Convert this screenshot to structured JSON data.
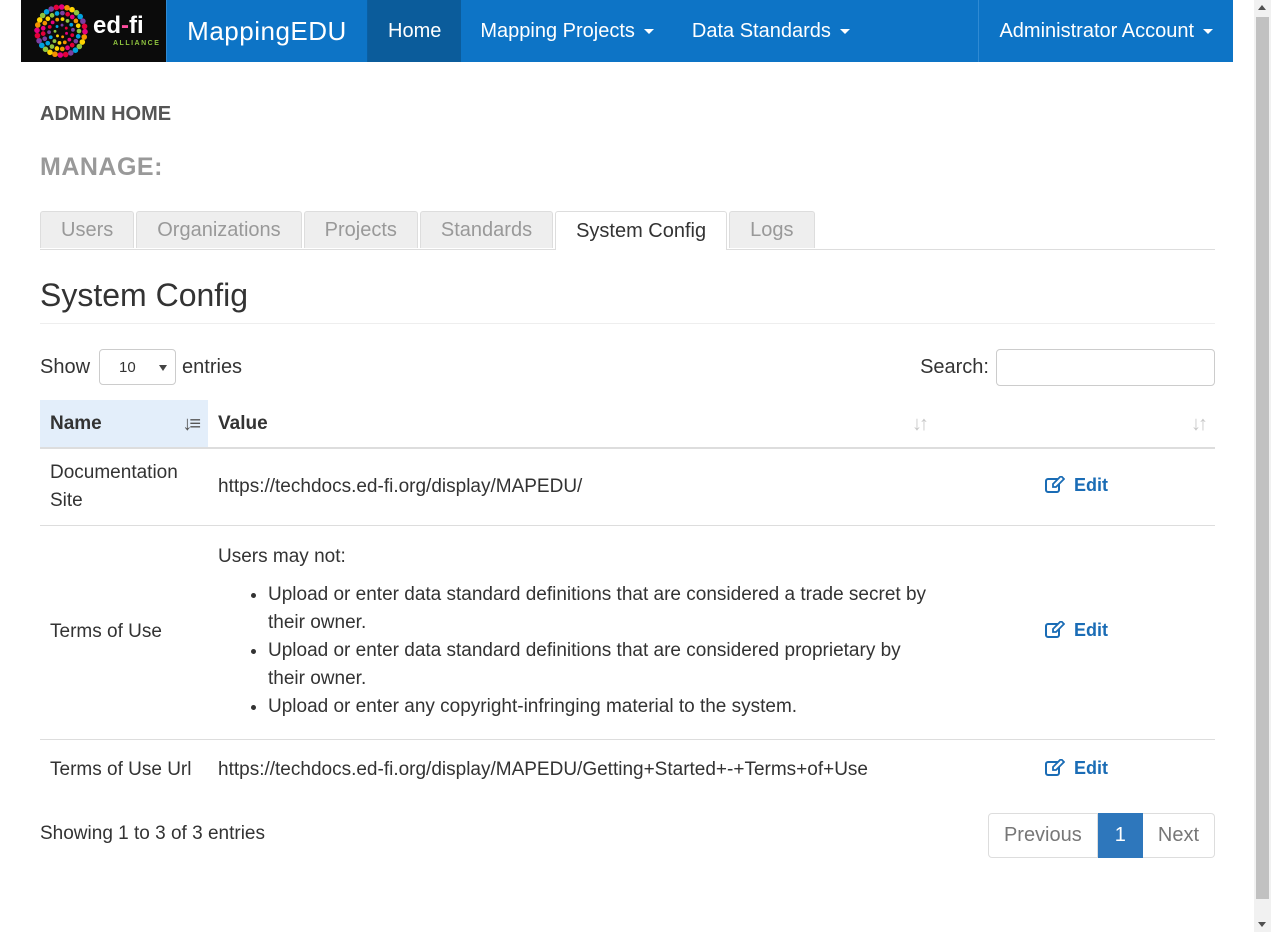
{
  "navbar": {
    "logo": {
      "word_left": "ed",
      "word_dot": "-",
      "word_right": "fi",
      "subtitle": "ALLIANCE"
    },
    "brand": "MappingEDU",
    "items": [
      {
        "label": "Home",
        "active": true
      },
      {
        "label": "Mapping Projects",
        "dropdown": true
      },
      {
        "label": "Data Standards",
        "dropdown": true
      }
    ],
    "account": "Administrator Account"
  },
  "page": {
    "heading": "ADMIN HOME",
    "manage": "MANAGE:",
    "tabs": [
      "Users",
      "Organizations",
      "Projects",
      "Standards",
      "System Config",
      "Logs"
    ],
    "active_tab": "System Config",
    "section_title": "System Config"
  },
  "table_controls": {
    "show_label": "Show",
    "entries_value": "10",
    "entries_label": "entries",
    "search_label": "Search:",
    "search_value": ""
  },
  "table": {
    "columns": [
      "Name",
      "Value",
      ""
    ],
    "sorted_column": "Name",
    "rows": [
      {
        "name": "Documentation Site",
        "value": "https://techdocs.ed-fi.org/display/MAPEDU/",
        "action": "Edit"
      },
      {
        "name": "Terms of Use",
        "value_intro": "Users may not:",
        "value_list": [
          "Upload or enter data standard definitions that are considered a trade secret by their owner.",
          "Upload or enter data standard definitions that are considered proprietary by their owner.",
          "Upload or enter any copyright-infringing material to the system."
        ],
        "action": "Edit"
      },
      {
        "name": "Terms of Use Url",
        "value": "https://techdocs.ed-fi.org/display/MAPEDU/Getting+Started+-+Terms+of+Use",
        "action": "Edit"
      }
    ]
  },
  "footer": {
    "showing": "Showing 1 to 3 of 3 entries",
    "pager": {
      "previous": "Previous",
      "current": "1",
      "next": "Next"
    }
  },
  "colors": {
    "navbar": "#0d74c6",
    "navbar_active": "#0b5c9b",
    "link": "#1a6cb5",
    "pager_active": "#2e77bc"
  },
  "icons": [
    "edit-icon",
    "sort-icon",
    "caret-down-icon"
  ]
}
